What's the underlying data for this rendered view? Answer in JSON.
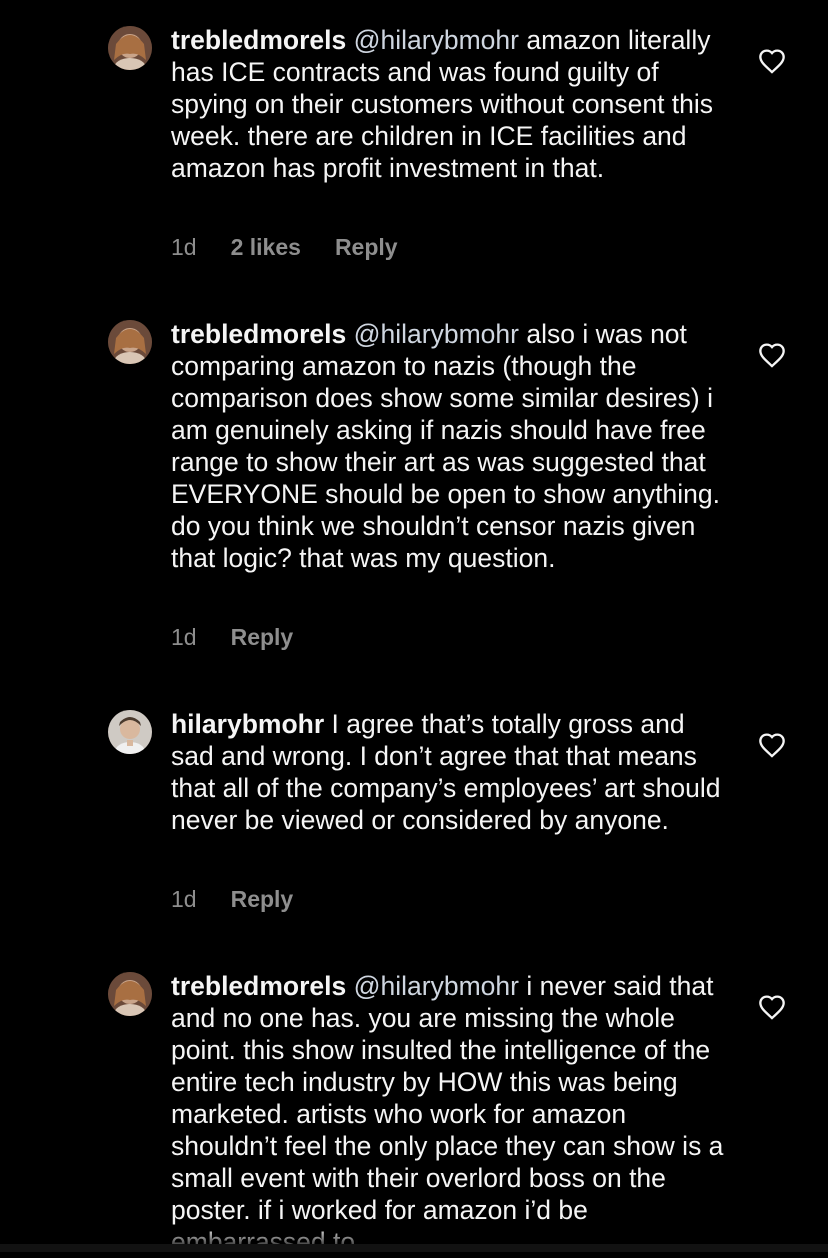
{
  "comments": [
    {
      "username": "trebledmorels",
      "mention": "@hilarybmohr",
      "body": "amazon literally has ICE contracts and was found guilty of spying on their customers without consent this week. there are children in ICE facilities and amazon has profit investment in that.",
      "time": "1d",
      "likes": "2 likes",
      "reply": "Reply",
      "avatar_icon": "profile-photo-woman-icon"
    },
    {
      "username": "trebledmorels",
      "mention": "@hilarybmohr",
      "body": "also i was not comparing amazon to nazis (though the comparison does show some similar desires) i am genuinely asking if nazis should have free range to show their art as was suggested that EVERYONE should be open to show anything. do you think we shouldn’t censor nazis given that logic? that was my question.",
      "time": "1d",
      "reply": "Reply",
      "avatar_icon": "profile-photo-woman-icon"
    },
    {
      "username": "hilarybmohr",
      "body": "I agree that’s totally gross and sad and wrong. I don’t agree that that means that all of the company’s employees’ art should never be viewed or considered by anyone.",
      "time": "1d",
      "reply": "Reply",
      "avatar_icon": "profile-photo-person-icon"
    },
    {
      "username": "trebledmorels",
      "mention": "@hilarybmohr",
      "body": "i never said that and no one has. you are missing the whole point. this show insulted the intelligence of the entire tech industry by HOW this was being marketed. artists who work for amazon shouldn’t feel the only place they can show is a small event with their overlord boss on the poster. if i worked for amazon i’d be embarrassed to",
      "avatar_icon": "profile-photo-woman-icon"
    }
  ],
  "icons": {
    "like": "heart-outline-icon"
  },
  "colors": {
    "background": "#000000",
    "text": "#f5f5f5",
    "meta": "#8e8e8e",
    "mention": "#cfd6e0"
  }
}
